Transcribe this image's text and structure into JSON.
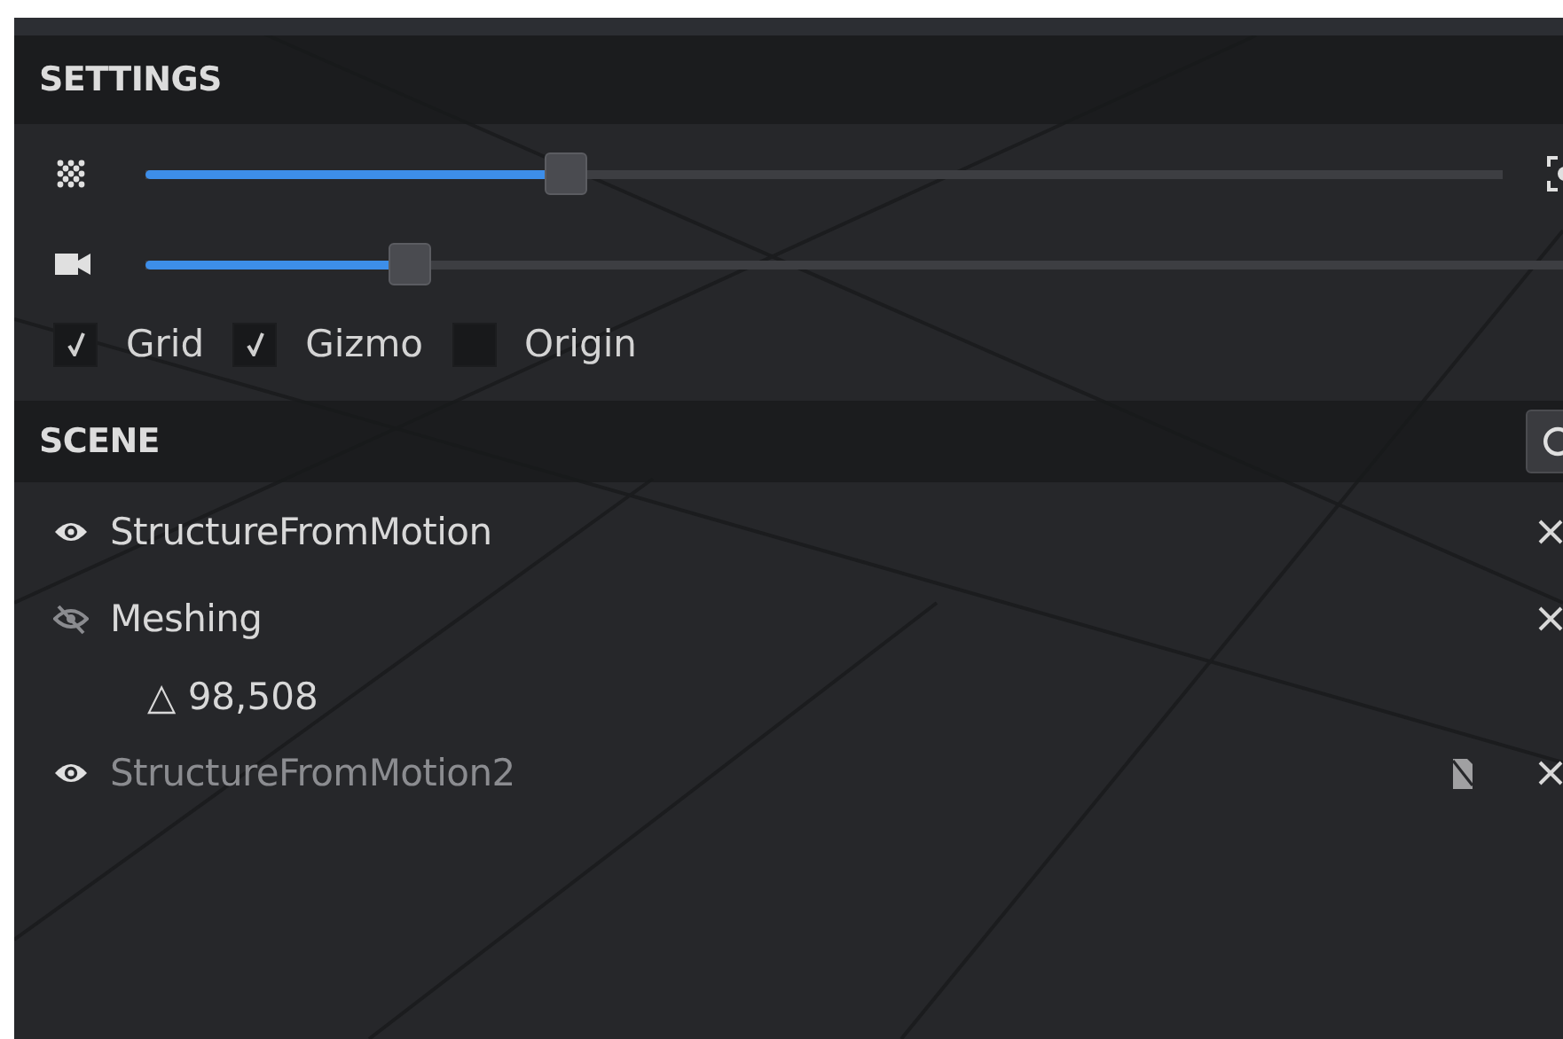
{
  "settings": {
    "title": "SETTINGS",
    "sliders": [
      {
        "kind": "points",
        "level": 0.31,
        "focus_button": true
      },
      {
        "kind": "camera",
        "level": 0.18
      }
    ],
    "toggles": [
      {
        "label": "Grid",
        "checked": true
      },
      {
        "label": "Gizmo",
        "checked": true
      },
      {
        "label": "Origin",
        "checked": false
      }
    ]
  },
  "scene": {
    "title": "SCENE",
    "items": [
      {
        "name": "StructureFromMotion",
        "visible": true,
        "dimmed": false,
        "missing_media": false
      },
      {
        "name": "Meshing",
        "visible": false,
        "dimmed": false,
        "missing_media": false,
        "stats": "△ 98,508"
      },
      {
        "name": "StructureFromMotion2",
        "visible": true,
        "dimmed": true,
        "missing_media": true
      }
    ]
  }
}
